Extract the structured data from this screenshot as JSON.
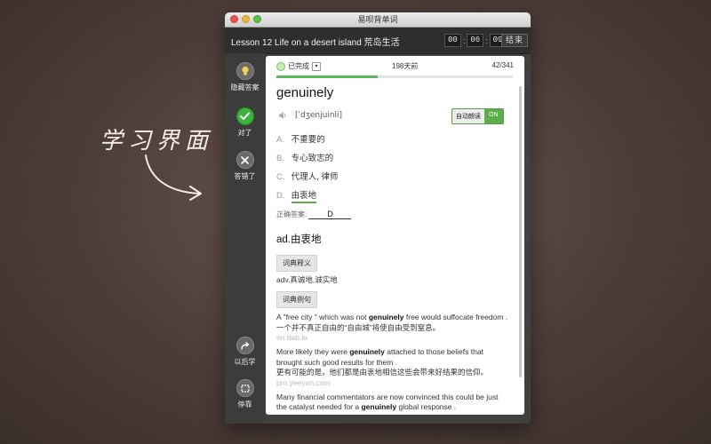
{
  "promo": {
    "caption": "学习界面"
  },
  "window": {
    "title": "易呗背单词",
    "lesson_title": "Lesson 12 Life on a desert island 荒岛生活",
    "timer": {
      "hours": "00",
      "minutes": "06",
      "seconds": "09"
    },
    "end_button": "结束"
  },
  "sidebar": {
    "items": [
      {
        "label": "隐藏答案",
        "icon": "lightbulb-icon"
      },
      {
        "label": "对了",
        "icon": "check-icon"
      },
      {
        "label": "答错了",
        "icon": "x-icon"
      },
      {
        "label": "以后学",
        "icon": "share-arrow-icon"
      },
      {
        "label": "停靠",
        "icon": "dock-icon"
      }
    ]
  },
  "card": {
    "status": "已完成",
    "days": "198天前",
    "count": "42/341",
    "progress": 0.43,
    "word": "genuinely",
    "phonetic": "[ˈdʒenjuinli]",
    "auto_read_label": "自动朗读",
    "auto_read_state": "ON",
    "options": [
      {
        "letter": "A.",
        "text": "不重要的"
      },
      {
        "letter": "B.",
        "text": "专心致志的"
      },
      {
        "letter": "C.",
        "text": "代理人, 律师"
      },
      {
        "letter": "D.",
        "text": "由衷地"
      }
    ],
    "correct_label": "正确答案:",
    "correct_answer": "D",
    "definition_main": "ad.由衷地",
    "dict_def_button": "词典释义",
    "dict_def": "adv.真诚地,诚实地",
    "dict_example_button": "词典例句",
    "examples": [
      {
        "en_before": "A \"free city \" which was not ",
        "en_bold": "genuinely",
        "en_after": " free would suffocate freedom .",
        "zh": "一个并不真正自由的“自由城”将使自由受到窒息。",
        "source": "en.bab.la"
      },
      {
        "en_before": "More likely they were ",
        "en_bold": "genuinely",
        "en_after": " attached to those beliefs that brought such good results for them .",
        "zh": "更有可能的是，他们都是由衷地相信这些会带来好结果的信仰。",
        "source": "pro.yeeyan.com"
      },
      {
        "en_before": "Many financial commentators are now convinced this could be just the catalyst needed for a ",
        "en_bold": "genuinely",
        "en_after": " global response ."
      }
    ]
  }
}
